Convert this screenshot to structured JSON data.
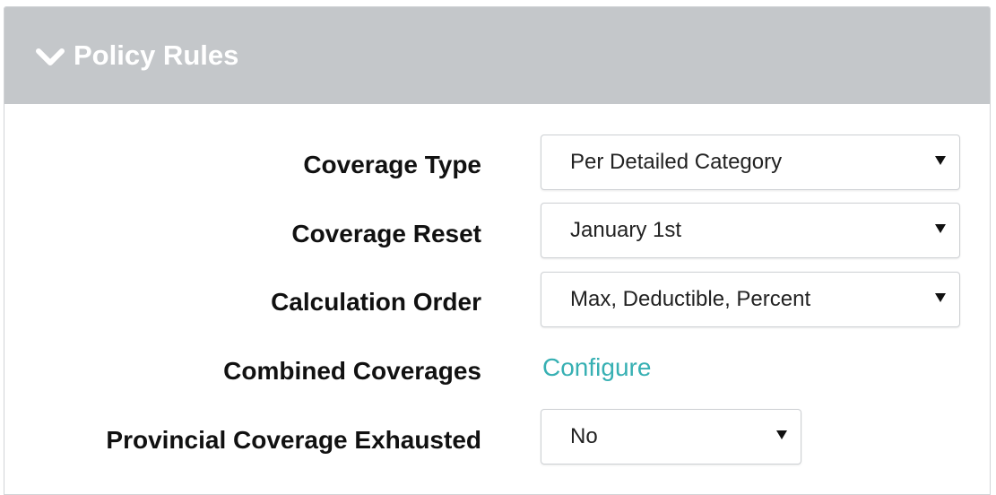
{
  "panel": {
    "title": "Policy Rules",
    "toggle_icon": "chevron-down-icon"
  },
  "fields": {
    "coverage_type": {
      "label": "Coverage Type",
      "value": "Per Detailed Category"
    },
    "coverage_reset": {
      "label": "Coverage Reset",
      "value": "January 1st"
    },
    "calculation_order": {
      "label": "Calculation Order",
      "value": "Max, Deductible, Percent"
    },
    "combined_coverages": {
      "label": "Combined Coverages",
      "link_text": "Configure"
    },
    "provincial_coverage_exhausted": {
      "label": "Provincial Coverage Exhausted",
      "value": "No"
    }
  },
  "colors": {
    "header_bg": "#c4c7ca",
    "link": "#37b0b3",
    "label_text": "#111111"
  }
}
